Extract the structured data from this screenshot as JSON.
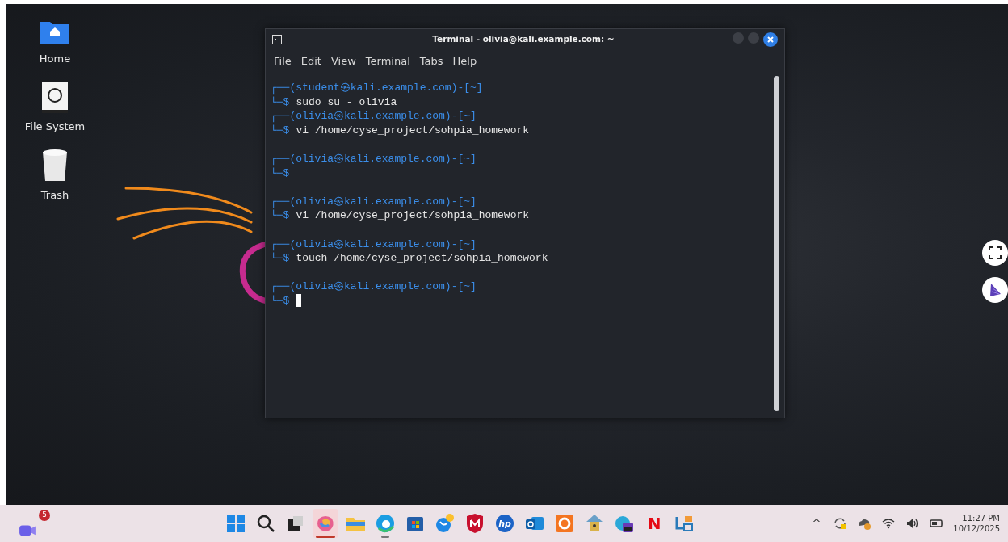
{
  "desktop_icons": [
    {
      "kind": "home",
      "label": "Home"
    },
    {
      "kind": "drive",
      "label": "File System"
    },
    {
      "kind": "trash",
      "label": "Trash"
    }
  ],
  "terminal": {
    "title": "Terminal - olivia@kali.example.com: ~",
    "menu": [
      "File",
      "Edit",
      "View",
      "Terminal",
      "Tabs",
      "Help"
    ],
    "lines": [
      {
        "kind": "prompt",
        "top": "┌──(student㉿kali.example.com)-[~]",
        "symbol": "└─$",
        "command": "sudo su - olivia"
      },
      {
        "kind": "prompt",
        "top": "┌──(olivia㉿kali.example.com)-[~]",
        "symbol": "└─$",
        "command": "vi /home/cyse_project/sohpia_homework"
      },
      {
        "kind": "blank"
      },
      {
        "kind": "prompt",
        "top": "┌──(olivia㉿kali.example.com)-[~]",
        "symbol": "└─$"
      },
      {
        "kind": "blank"
      },
      {
        "kind": "prompt",
        "top": "┌──(olivia㉿kali.example.com)-[~]",
        "symbol": "└─$",
        "command": "vi /home/cyse_project/sohpia_homework"
      },
      {
        "kind": "blank"
      },
      {
        "kind": "prompt",
        "top": "┌──(olivia㉿kali.example.com)-[~]",
        "symbol": "└─$",
        "command": "touch /home/cyse_project/sohpia_homework"
      },
      {
        "kind": "blank"
      },
      {
        "kind": "prompt",
        "top": "┌──(olivia㉿kali.example.com)-[~]",
        "symbol": "└─$",
        "cursor": true
      }
    ]
  },
  "side_buttons": [
    {
      "kind": "fullscreen"
    },
    {
      "kind": "cone"
    }
  ],
  "taskbar": {
    "left": {
      "kind": "meet",
      "badge": "5"
    },
    "apps": [
      {
        "kind": "windows",
        "selected": false,
        "running": false
      },
      {
        "kind": "search",
        "selected": false,
        "running": false
      },
      {
        "kind": "taskview",
        "selected": false,
        "running": false
      },
      {
        "kind": "copilot",
        "selected": true,
        "running": true
      },
      {
        "kind": "folder",
        "selected": false,
        "running": false
      },
      {
        "kind": "edge",
        "selected": false,
        "running": true
      },
      {
        "kind": "store",
        "selected": false,
        "running": false
      },
      {
        "kind": "globe",
        "selected": false,
        "running": false
      },
      {
        "kind": "shield",
        "selected": false,
        "running": false
      },
      {
        "kind": "hp",
        "label": "hp",
        "selected": false,
        "running": false
      },
      {
        "kind": "mail",
        "selected": false,
        "running": false
      },
      {
        "kind": "crunchy",
        "selected": false,
        "running": false
      },
      {
        "kind": "lock",
        "selected": false,
        "running": false
      },
      {
        "kind": "photos",
        "selected": false,
        "running": false
      },
      {
        "kind": "netflix",
        "label": "N",
        "selected": false,
        "running": false
      },
      {
        "kind": "board",
        "selected": false,
        "running": false
      }
    ],
    "tray": {
      "chevron": "^",
      "icons": [
        {
          "kind": "sync"
        },
        {
          "kind": "cloud"
        },
        {
          "kind": "wifi"
        },
        {
          "kind": "volume"
        },
        {
          "kind": "battery"
        }
      ],
      "time": "11:27 PM",
      "date": "10/12/2025"
    }
  }
}
